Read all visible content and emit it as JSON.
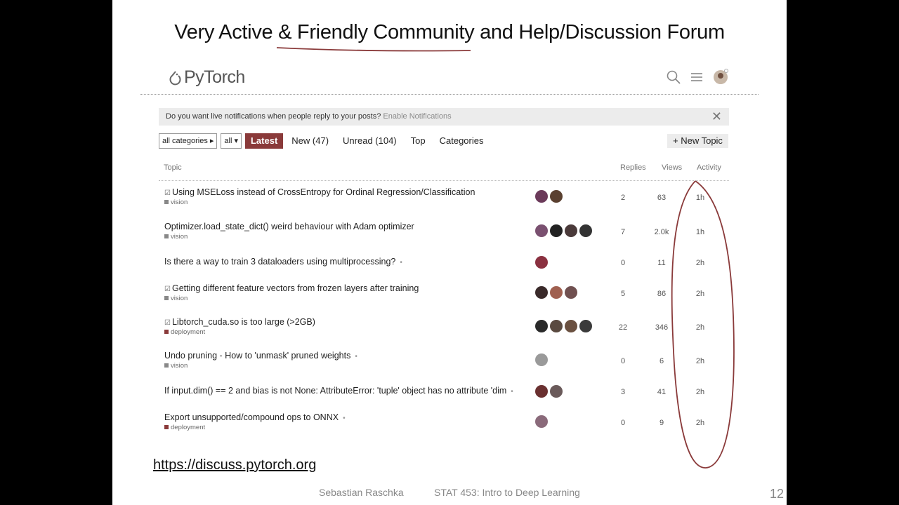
{
  "slide": {
    "title": "Very Active & Friendly Community and Help/Discussion Forum",
    "url": "https://discuss.pytorch.org",
    "author": "Sebastian Raschka",
    "course": "STAT 453: Intro to Deep Learning",
    "page_number": "12"
  },
  "forum": {
    "logo_text": "PyTorch",
    "header_icons": [
      "search-icon",
      "hamburger-icon",
      "user-avatar"
    ],
    "notice": {
      "question": "Do you want live notifications when people reply to your posts?",
      "enable_link": "Enable Notifications",
      "close": "✕"
    },
    "nav": {
      "category_dropdown": "all categories ▸",
      "tag_dropdown": "all ▾",
      "tabs": [
        "Latest",
        "New (47)",
        "Unread (104)",
        "Top",
        "Categories"
      ],
      "active_tab": "Latest",
      "new_topic": "+ New Topic"
    },
    "columns": {
      "topic": "Topic",
      "replies": "Replies",
      "views": "Views",
      "activity": "Activity"
    },
    "topics": [
      {
        "title": "Using MSELoss instead of CrossEntropy for Ordinal Regression/Classification",
        "solved": true,
        "pinned": false,
        "category": "vision",
        "cat_color": "#888888",
        "replies": "2",
        "views": "63",
        "activity": "1h",
        "avatars": [
          "#6b3a5a",
          "#5a4030"
        ]
      },
      {
        "title": "Optimizer.load_state_dict() weird behaviour with Adam optimizer",
        "solved": false,
        "pinned": false,
        "category": "vision",
        "cat_color": "#888888",
        "replies": "7",
        "views": "2.0k",
        "activity": "1h",
        "avatars": [
          "#7a5070",
          "#222222",
          "#4a3a3a",
          "#333333"
        ]
      },
      {
        "title": "Is there a way to train 3 dataloaders using multiprocessing?",
        "solved": false,
        "pinned": true,
        "category": "",
        "cat_color": "",
        "replies": "0",
        "views": "11",
        "activity": "2h",
        "avatars": [
          "#8a3040"
        ]
      },
      {
        "title": "Getting different feature vectors from frozen layers after training",
        "solved": true,
        "pinned": false,
        "category": "vision",
        "cat_color": "#888888",
        "replies": "5",
        "views": "86",
        "activity": "2h",
        "avatars": [
          "#3a2a2a",
          "#a06050",
          "#705050"
        ]
      },
      {
        "title": "Libtorch_cuda.so is too large (>2GB)",
        "solved": true,
        "pinned": false,
        "category": "deployment",
        "cat_color": "#8a3a3a",
        "replies": "22",
        "views": "346",
        "activity": "2h",
        "avatars": [
          "#2a2a2a",
          "#5a4a40",
          "#6a5040",
          "#3a3a3a"
        ]
      },
      {
        "title": "Undo pruning - How to 'unmask' pruned weights",
        "solved": false,
        "pinned": true,
        "category": "vision",
        "cat_color": "#888888",
        "replies": "0",
        "views": "6",
        "activity": "2h",
        "avatars": [
          "#9a9a9a"
        ]
      },
      {
        "title": "If input.dim() == 2 and bias is not None: AttributeError: 'tuple' object has no attribute 'dim",
        "solved": false,
        "pinned": true,
        "category": "",
        "cat_color": "",
        "replies": "3",
        "views": "41",
        "activity": "2h",
        "avatars": [
          "#6a3030",
          "#6a5a5a"
        ]
      },
      {
        "title": "Export unsupported/compound ops to ONNX",
        "solved": false,
        "pinned": true,
        "category": "deployment",
        "cat_color": "#8a3a3a",
        "replies": "0",
        "views": "9",
        "activity": "2h",
        "avatars": [
          "#8a6a7a"
        ]
      }
    ]
  }
}
